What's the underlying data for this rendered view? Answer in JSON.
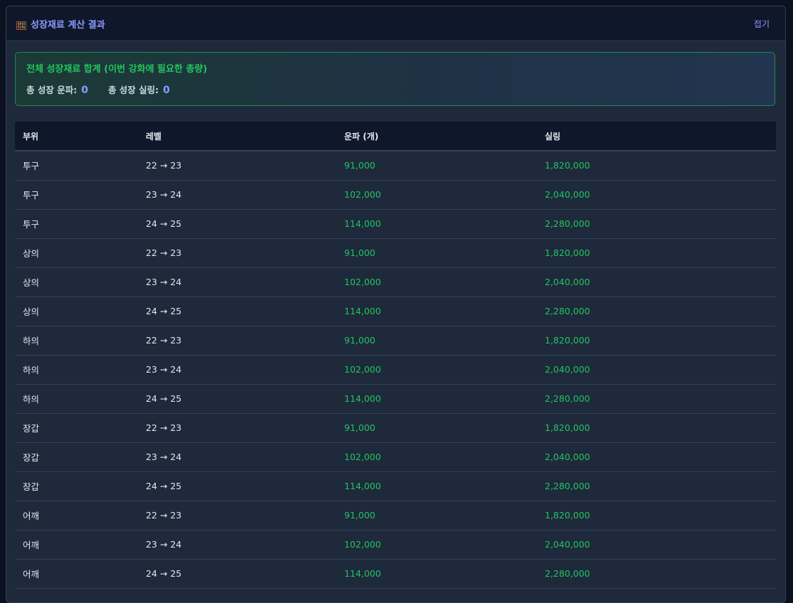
{
  "header": {
    "title": "성장재료 계산 결과",
    "collapse_label": "접기",
    "icon": "abacus-icon"
  },
  "summary": {
    "title": "전체 성장재료 합계 (이번 강화에 필요한 총량)",
    "stats": [
      {
        "label": "총 성장 운파:",
        "value": "0"
      },
      {
        "label": "총 성장 실링:",
        "value": "0"
      }
    ]
  },
  "table": {
    "columns": [
      "부위",
      "레벨",
      "운파 (개)",
      "실링"
    ],
    "rows": [
      [
        "투구",
        "22 → 23",
        "91,000",
        "1,820,000"
      ],
      [
        "투구",
        "23 → 24",
        "102,000",
        "2,040,000"
      ],
      [
        "투구",
        "24 → 25",
        "114,000",
        "2,280,000"
      ],
      [
        "상의",
        "22 → 23",
        "91,000",
        "1,820,000"
      ],
      [
        "상의",
        "23 → 24",
        "102,000",
        "2,040,000"
      ],
      [
        "상의",
        "24 → 25",
        "114,000",
        "2,280,000"
      ],
      [
        "하의",
        "22 → 23",
        "91,000",
        "1,820,000"
      ],
      [
        "하의",
        "23 → 24",
        "102,000",
        "2,040,000"
      ],
      [
        "하의",
        "24 → 25",
        "114,000",
        "2,280,000"
      ],
      [
        "장갑",
        "22 → 23",
        "91,000",
        "1,820,000"
      ],
      [
        "장갑",
        "23 → 24",
        "102,000",
        "2,040,000"
      ],
      [
        "장갑",
        "24 → 25",
        "114,000",
        "2,280,000"
      ],
      [
        "어깨",
        "22 → 23",
        "91,000",
        "1,820,000"
      ],
      [
        "어깨",
        "23 → 24",
        "102,000",
        "2,040,000"
      ],
      [
        "어깨",
        "24 → 25",
        "114,000",
        "2,280,000"
      ]
    ]
  },
  "colors": {
    "accent": "#8b9cff",
    "positive": "#22c55e",
    "panel_bg": "#1e293b",
    "header_bg": "#0f172a"
  }
}
